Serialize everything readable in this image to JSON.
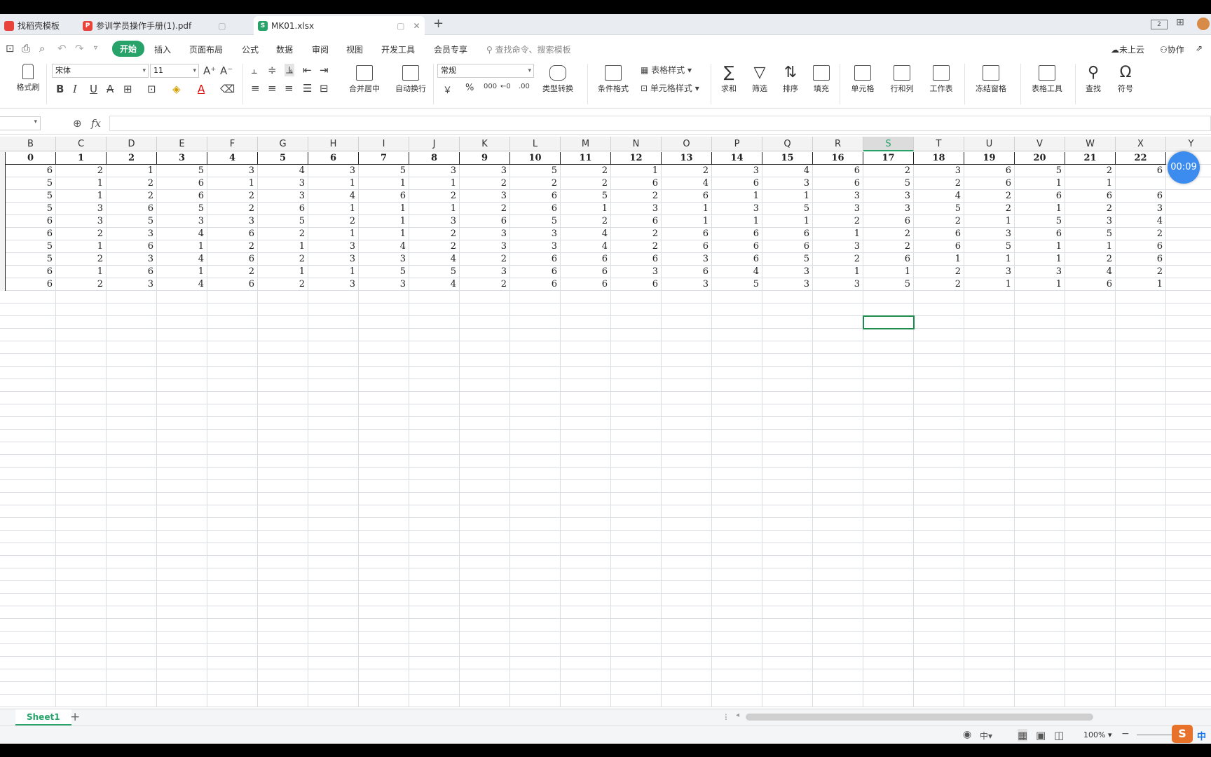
{
  "tabs": [
    {
      "label": "找稻壳模板",
      "icon": "docer-icon",
      "active": false
    },
    {
      "label": "参训学员操作手册(1).pdf",
      "icon": "pdf-icon",
      "active": false
    },
    {
      "label": "MK01.xlsx",
      "icon": "spreadsheet-icon",
      "active": true
    }
  ],
  "menu": {
    "items": [
      "开始",
      "插入",
      "页面布局",
      "公式",
      "数据",
      "审阅",
      "视图",
      "开发工具",
      "会员专享"
    ],
    "active": "开始",
    "search_placeholder": "查找命令、搜索模板",
    "cloud": "未上云",
    "collab": "协作"
  },
  "ribbon": {
    "format_painter": "格式刷",
    "font_name": "宋体",
    "font_size": "11",
    "bold": "B",
    "italic": "I",
    "underline": "U",
    "merge_center": "合并居中",
    "wrap_text": "自动换行",
    "number_format": "常规",
    "currency": "￥",
    "percent": "%",
    "type_convert": "类型转换",
    "conditional_format": "条件格式",
    "table_style": "表格样式",
    "cell_style": "单元格样式",
    "sum": "求和",
    "filter": "筛选",
    "sort": "排序",
    "fill": "填充",
    "cell": "单元格",
    "row_col": "行和列",
    "worksheet": "工作表",
    "freeze": "冻结窗格",
    "table_tools": "表格工具",
    "find": "查找",
    "symbol": "符号"
  },
  "formula_bar": {
    "fx": "fx",
    "content": ""
  },
  "columns": [
    "B",
    "C",
    "D",
    "E",
    "F",
    "G",
    "H",
    "I",
    "J",
    "K",
    "L",
    "M",
    "N",
    "O",
    "P",
    "Q",
    "R",
    "S",
    "T",
    "U",
    "V",
    "W",
    "X",
    "Y"
  ],
  "selected_column": "S",
  "header_row": [
    "0",
    "1",
    "2",
    "3",
    "4",
    "5",
    "6",
    "7",
    "8",
    "9",
    "10",
    "11",
    "12",
    "13",
    "14",
    "15",
    "16",
    "17",
    "18",
    "19",
    "20",
    "21",
    "22",
    ""
  ],
  "rows": [
    [
      "6",
      "2",
      "1",
      "5",
      "3",
      "4",
      "3",
      "5",
      "3",
      "3",
      "5",
      "2",
      "1",
      "2",
      "3",
      "4",
      "6",
      "2",
      "3",
      "6",
      "5",
      "2",
      "6",
      ""
    ],
    [
      "5",
      "1",
      "2",
      "6",
      "1",
      "3",
      "1",
      "1",
      "1",
      "2",
      "2",
      "2",
      "6",
      "4",
      "6",
      "3",
      "6",
      "5",
      "2",
      "6",
      "1",
      "1",
      "",
      ""
    ],
    [
      "5",
      "1",
      "2",
      "6",
      "2",
      "3",
      "4",
      "6",
      "2",
      "3",
      "6",
      "5",
      "2",
      "6",
      "1",
      "1",
      "3",
      "3",
      "4",
      "2",
      "6",
      "6",
      "6",
      ""
    ],
    [
      "5",
      "3",
      "6",
      "5",
      "2",
      "6",
      "1",
      "1",
      "1",
      "2",
      "6",
      "1",
      "3",
      "1",
      "3",
      "5",
      "3",
      "3",
      "5",
      "2",
      "1",
      "2",
      "3",
      ""
    ],
    [
      "6",
      "3",
      "5",
      "3",
      "3",
      "5",
      "2",
      "1",
      "3",
      "6",
      "5",
      "2",
      "6",
      "1",
      "1",
      "1",
      "2",
      "6",
      "2",
      "1",
      "5",
      "3",
      "4",
      ""
    ],
    [
      "6",
      "2",
      "3",
      "4",
      "6",
      "2",
      "1",
      "1",
      "2",
      "3",
      "3",
      "4",
      "2",
      "6",
      "6",
      "6",
      "1",
      "2",
      "6",
      "3",
      "6",
      "5",
      "2",
      ""
    ],
    [
      "5",
      "1",
      "6",
      "1",
      "2",
      "1",
      "3",
      "4",
      "2",
      "3",
      "3",
      "4",
      "2",
      "6",
      "6",
      "6",
      "3",
      "2",
      "6",
      "5",
      "1",
      "1",
      "6",
      ""
    ],
    [
      "5",
      "2",
      "3",
      "4",
      "6",
      "2",
      "3",
      "3",
      "4",
      "2",
      "6",
      "6",
      "6",
      "3",
      "6",
      "5",
      "2",
      "6",
      "1",
      "1",
      "1",
      "2",
      "6",
      ""
    ],
    [
      "6",
      "1",
      "6",
      "1",
      "2",
      "1",
      "1",
      "5",
      "5",
      "3",
      "6",
      "6",
      "3",
      "6",
      "4",
      "3",
      "1",
      "1",
      "2",
      "3",
      "3",
      "4",
      "2",
      ""
    ],
    [
      "6",
      "2",
      "3",
      "4",
      "6",
      "2",
      "3",
      "3",
      "4",
      "2",
      "6",
      "6",
      "6",
      "3",
      "5",
      "3",
      "3",
      "5",
      "2",
      "1",
      "1",
      "6",
      "1",
      ""
    ]
  ],
  "timer": "00:09",
  "sheet_tab": "Sheet1",
  "status": {
    "zoom": "100%",
    "ime": "中"
  }
}
